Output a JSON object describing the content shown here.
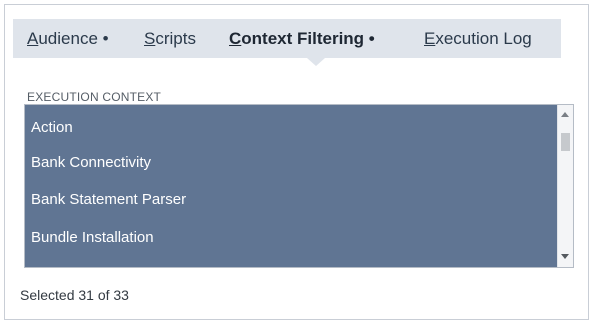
{
  "tabs": {
    "audience": {
      "accel": "A",
      "rest": "udience",
      "marker": " •"
    },
    "scripts": {
      "accel": "S",
      "rest": "cripts",
      "marker": ""
    },
    "context": {
      "accel": "C",
      "rest": "ontext Filtering",
      "marker": " •"
    },
    "log": {
      "accel": "E",
      "rest": "xecution Log",
      "marker": ""
    },
    "active": "Context Filtering"
  },
  "execution_context": {
    "label": "EXECUTION CONTEXT",
    "options": [
      "Action",
      "Bank Connectivity",
      "Bank Statement Parser",
      "Bundle Installation"
    ]
  },
  "status": {
    "text": "Selected 31 of 33"
  },
  "colors": {
    "tab_bar": "#dfe4eb",
    "selected_list_bg": "#607593",
    "selected_text": "#ffffff"
  }
}
